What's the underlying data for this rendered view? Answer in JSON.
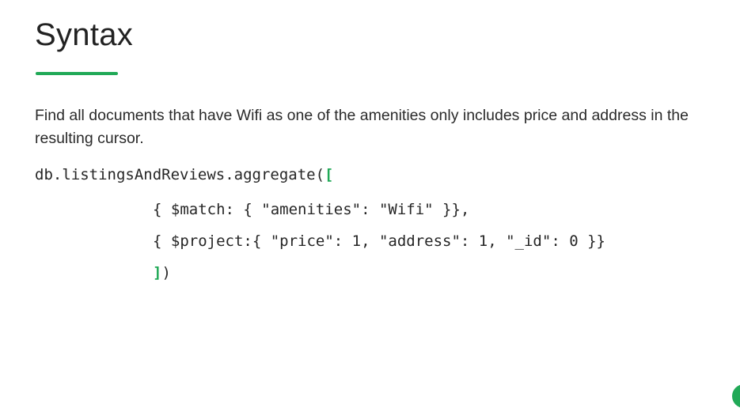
{
  "slide": {
    "title": "Syntax",
    "description": "Find all documents that have Wifi as one of the amenities only includes price and address in the resulting cursor."
  },
  "code": {
    "line1_text": "db.listingsAndReviews.aggregate(",
    "line1_bracket": "[",
    "line2_text": "{ $match: { \"amenities\": \"Wifi\" }},",
    "line3_text": "{ $project:{ \"price\": 1, \"address\": 1, \"_id\": 0 }}",
    "line4_bracket": "]",
    "line4_text": ")"
  },
  "colors": {
    "accent": "#21a957",
    "text": "#222222"
  }
}
